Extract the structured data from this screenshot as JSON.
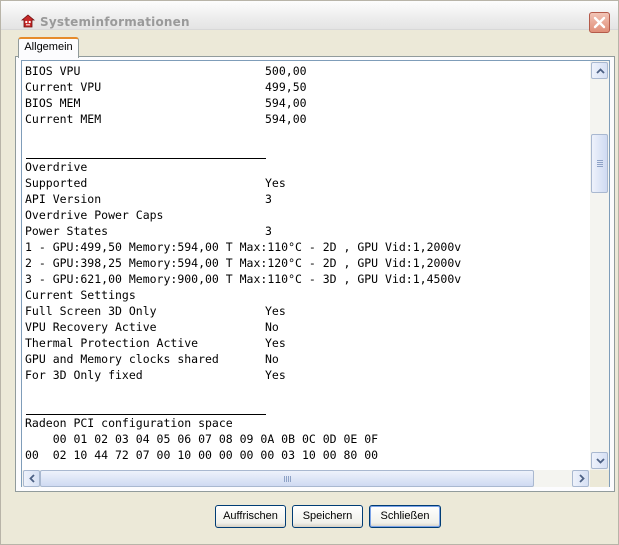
{
  "window": {
    "title": "Systeminformationen",
    "accent": "#e68b2c"
  },
  "tabs": [
    {
      "label": "Allgemein",
      "active": true
    }
  ],
  "icons": {
    "app": "app-icon",
    "close": "close-icon"
  },
  "info_lines": [
    {
      "label": "BIOS VPU",
      "value": "500,00"
    },
    {
      "label": "Current VPU",
      "value": "499,50"
    },
    {
      "label": "BIOS MEM",
      "value": "594,00"
    },
    {
      "label": "Current MEM",
      "value": "594,00"
    },
    {
      "label": "",
      "value": ""
    },
    {
      "label": "",
      "value": "",
      "separator": true
    },
    {
      "label": "Overdrive",
      "value": ""
    },
    {
      "label": "Supported",
      "value": "Yes"
    },
    {
      "label": "API Version",
      "value": "3"
    },
    {
      "label": "Overdrive Power Caps",
      "value": ""
    },
    {
      "label": "Power States",
      "value": "3"
    },
    {
      "label": "1 - GPU:499,50 Memory:594,00 T Max:110°C - 2D , GPU Vid:1,2000v",
      "value": ""
    },
    {
      "label": "2 - GPU:398,25 Memory:594,00 T Max:120°C - 2D , GPU Vid:1,2000v",
      "value": ""
    },
    {
      "label": "3 - GPU:621,00 Memory:900,00 T Max:110°C - 3D , GPU Vid:1,4500v",
      "value": ""
    },
    {
      "label": "Current Settings",
      "value": ""
    },
    {
      "label": "Full Screen 3D Only",
      "value": "Yes"
    },
    {
      "label": "VPU Recovery Active",
      "value": "No"
    },
    {
      "label": "Thermal Protection Active",
      "value": "Yes"
    },
    {
      "label": "GPU and Memory clocks shared",
      "value": "No"
    },
    {
      "label": "For 3D Only fixed",
      "value": "Yes"
    },
    {
      "label": "",
      "value": ""
    },
    {
      "label": "",
      "value": "",
      "separator": true
    },
    {
      "label": "Radeon PCI configuration space",
      "value": ""
    },
    {
      "label": "    00 01 02 03 04 05 06 07 08 09 0A 0B 0C 0D 0E 0F",
      "value": ""
    },
    {
      "label": "00  02 10 44 72 07 00 10 00 00 00 00 03 10 00 80 00",
      "value": ""
    }
  ],
  "buttons": {
    "refresh": "Auffrischen",
    "save": "Speichern",
    "close": "Schließen"
  }
}
